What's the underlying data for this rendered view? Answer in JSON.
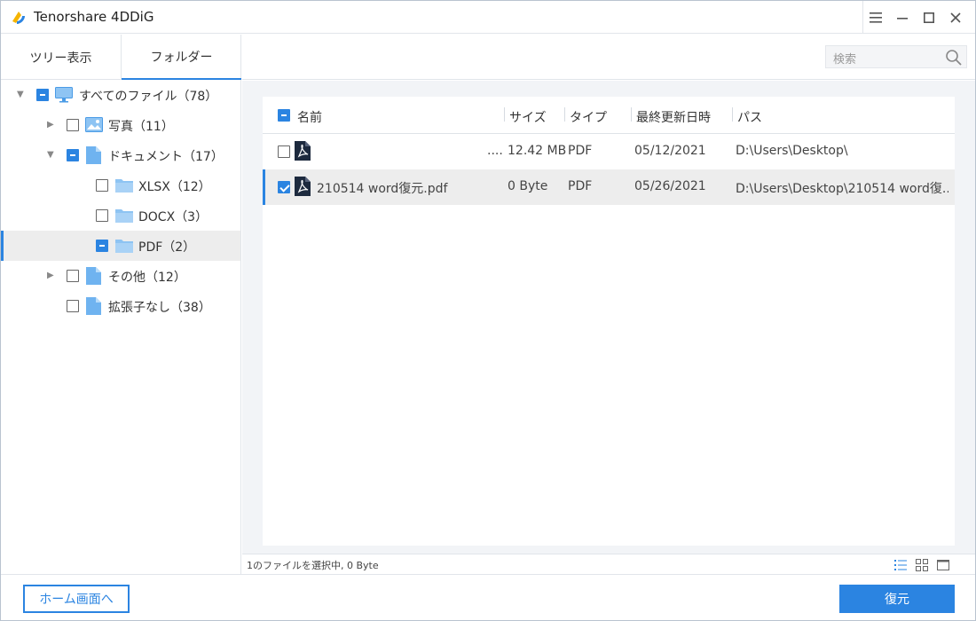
{
  "app": {
    "title": "Tenorshare 4DDiG"
  },
  "tabs": [
    {
      "label": "ツリー表示"
    },
    {
      "label": "フォルダー"
    }
  ],
  "tree": [
    {
      "label": "すべてのファイル（78）",
      "icon": "computer-icon",
      "check": "partial"
    },
    {
      "label": "写真（11）",
      "icon": "image-icon",
      "check": "unchecked"
    },
    {
      "label": "ドキュメント（17）",
      "icon": "document-icon",
      "check": "partial"
    },
    {
      "label": "XLSX（12）",
      "icon": "folder-icon",
      "check": "unchecked"
    },
    {
      "label": "DOCX（3）",
      "icon": "folder-icon",
      "check": "unchecked"
    },
    {
      "label": "PDF（2）",
      "icon": "folder-icon",
      "check": "partial"
    },
    {
      "label": "その他（12）",
      "icon": "document-icon",
      "check": "unchecked"
    },
    {
      "label": "拡張子なし（38）",
      "icon": "document-icon",
      "check": "unchecked"
    }
  ],
  "search": {
    "placeholder": "検索"
  },
  "table": {
    "headers": {
      "name": "名前",
      "size": "サイズ",
      "type": "タイプ",
      "modified": "最終更新日時",
      "path": "パス"
    },
    "rows": [
      {
        "name": "....",
        "size": "12.42 MB",
        "type": "PDF",
        "modified": "05/12/2021",
        "path": "D:\\Users\\Desktop\\",
        "checked": false
      },
      {
        "name": "210514 word復元.pdf",
        "size": "0 Byte",
        "type": "PDF",
        "modified": "05/26/2021",
        "path": "D:\\Users\\Desktop\\210514 word復...",
        "checked": true
      }
    ]
  },
  "status": {
    "text": "1のファイルを選択中, 0 Byte"
  },
  "buttons": {
    "home": "ホーム画面へ",
    "restore": "復元"
  },
  "colors": {
    "accent": "#2b84e1",
    "selected_row": "#ededed",
    "area_bg": "#f2f4f7"
  }
}
